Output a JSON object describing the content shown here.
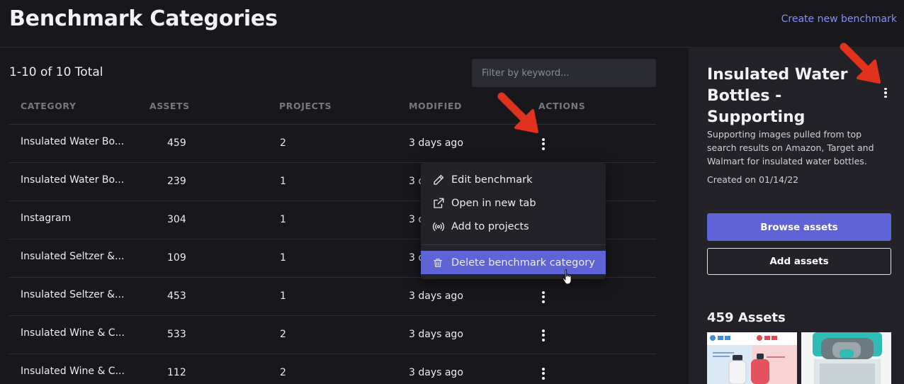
{
  "header": {
    "title": "Benchmark Categories",
    "create_link": "Create new benchmark"
  },
  "toolbar": {
    "total": "1-10 of 10 Total",
    "filter_placeholder": "Filter by keyword..."
  },
  "table": {
    "columns": [
      "CATEGORY",
      "ASSETS",
      "PROJECTS",
      "MODIFIED",
      "ACTIONS"
    ],
    "rows": [
      {
        "category": "Insulated Water Bo...",
        "assets": "459",
        "projects": "2",
        "modified": "3 days ago"
      },
      {
        "category": "Insulated Water Bo...",
        "assets": "239",
        "projects": "1",
        "modified": "3 days ago"
      },
      {
        "category": "Instagram",
        "assets": "304",
        "projects": "1",
        "modified": "3 days ago"
      },
      {
        "category": "Insulated Seltzer &...",
        "assets": "109",
        "projects": "1",
        "modified": "3 days ago"
      },
      {
        "category": "Insulated Seltzer &...",
        "assets": "453",
        "projects": "1",
        "modified": "3 days ago"
      },
      {
        "category": "Insulated Wine & C...",
        "assets": "533",
        "projects": "2",
        "modified": "3 days ago"
      },
      {
        "category": "Insulated Wine & C...",
        "assets": "112",
        "projects": "2",
        "modified": "3 days ago"
      }
    ]
  },
  "context_menu": {
    "items": [
      {
        "label": "Edit benchmark",
        "icon": "pencil-icon"
      },
      {
        "label": "Open in new tab",
        "icon": "external-link-icon"
      },
      {
        "label": "Add to projects",
        "icon": "broadcast-icon"
      },
      {
        "label": "Delete benchmark category",
        "icon": "trash-icon"
      }
    ],
    "accent_color": "#5e63d6"
  },
  "sidebar": {
    "title": "Insulated Water Bottles - Supporting",
    "description": "Supporting images pulled from top search results on Amazon, Target and Walmart for insulated water bottles.",
    "created": "Created on 01/14/22",
    "browse_button": "Browse assets",
    "add_button": "Add assets",
    "assets_count": "459 Assets"
  },
  "colors": {
    "background": "#18181c",
    "panel": "#222228",
    "accent": "#5e63d6",
    "link": "#8b8df0",
    "annotation_arrow": "#e0321c"
  }
}
